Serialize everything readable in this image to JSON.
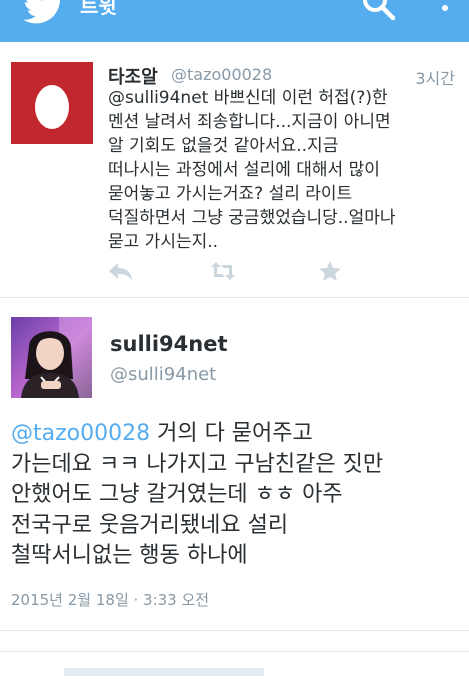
{
  "appbar": {
    "title": "트윗",
    "bird_icon": "twitter-bird-icon",
    "search_icon": "search-icon",
    "more_icon": "more-vertical-icon",
    "color": "#55acee"
  },
  "reply_tweet": {
    "name": "타조알",
    "handle": "@tazo00028",
    "time": "3시간",
    "avatar": "default-egg-avatar",
    "body_mention": "@sulli94net",
    "body_lines": [
      " 바쁘신데 이런 허접(?)한",
      "멘션 날려서 죄송합니다...지금이 아니면",
      "알 기회도 없을것 같아서요..지금",
      "떠나시는 과정에서 설리에 대해서 많이",
      "묻어놓고 가시는거죠? 설리 라이트",
      "덕질하면서 그냥 궁금했었습니당..얼마나",
      "묻고 가시는지.."
    ],
    "actions": [
      "reply-icon",
      "retweet-icon",
      "favorite-icon"
    ]
  },
  "main_tweet": {
    "name": "sulli94net",
    "handle": "@sulli94net",
    "avatar": "profile-photo",
    "body_mention": "@tazo00028",
    "body_lines": [
      " 거의 다 묻어주고",
      "가는데요 ㅋㅋ 나가지고 구남친같은 짓만",
      "안했어도 그냥 갈거였는데 ㅎㅎ 아주",
      "전국구로 웃음거리됐네요 설리",
      "철딱서니없는 행동 하나에"
    ],
    "date": "2015년 2월 18일 · 3:33 오전"
  }
}
